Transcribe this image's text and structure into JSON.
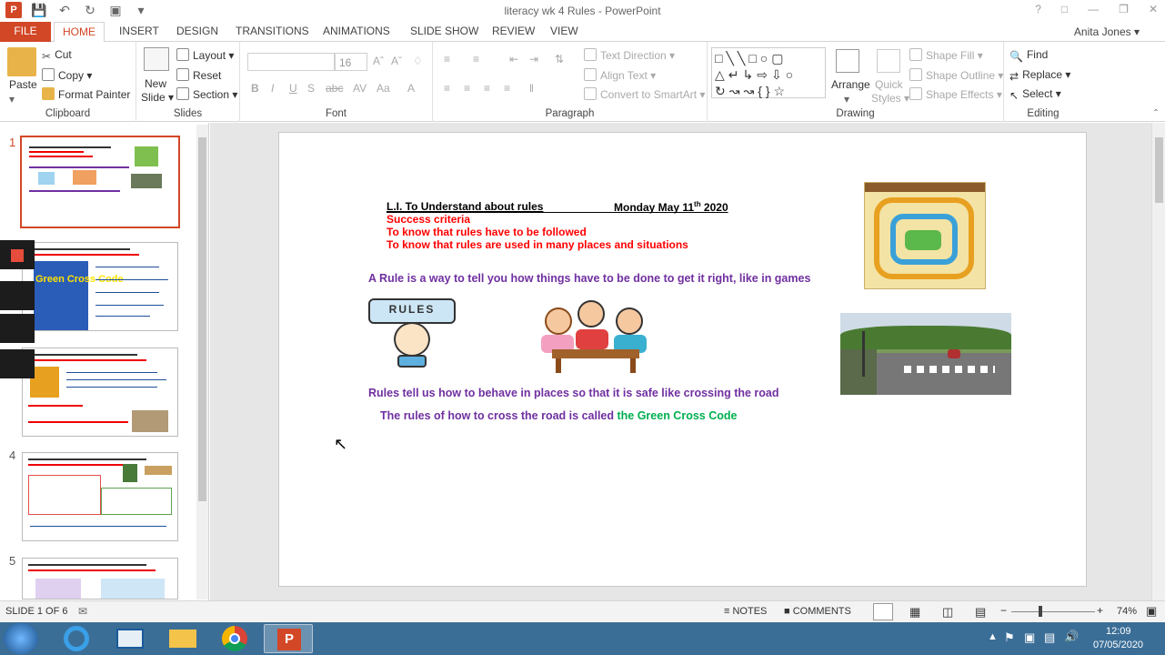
{
  "window": {
    "title": "literacy wk 4 Rules - PowerPoint",
    "user": "Anita Jones"
  },
  "tabs": [
    "FILE",
    "HOME",
    "INSERT",
    "DESIGN",
    "TRANSITIONS",
    "ANIMATIONS",
    "SLIDE SHOW",
    "REVIEW",
    "VIEW"
  ],
  "active_tab": "HOME",
  "ribbon": {
    "clipboard": {
      "label": "Clipboard",
      "paste": "Paste",
      "cut": "Cut",
      "copy": "Copy",
      "format_painter": "Format Painter"
    },
    "slides": {
      "label": "Slides",
      "new_slide_1": "New",
      "new_slide_2": "Slide",
      "layout": "Layout",
      "reset": "Reset",
      "section": "Section"
    },
    "font": {
      "label": "Font",
      "size": "16"
    },
    "paragraph": {
      "label": "Paragraph",
      "text_direction": "Text Direction",
      "align_text": "Align Text",
      "convert": "Convert to SmartArt"
    },
    "drawing": {
      "label": "Drawing",
      "arrange": "Arrange",
      "quick_styles_1": "Quick",
      "quick_styles_2": "Styles",
      "shape_fill": "Shape Fill",
      "shape_outline": "Shape Outline",
      "shape_effects": "Shape Effects"
    },
    "editing": {
      "label": "Editing",
      "find": "Find",
      "replace": "Replace",
      "select": "Select"
    }
  },
  "thumbnails": [
    "1",
    "4",
    "5"
  ],
  "slide": {
    "li_title": "L.I. To Understand about rules",
    "date_prefix": "Monday  May 11",
    "date_sup": "th",
    "date_year": " 2020",
    "success": "Success criteria",
    "crit1": "To know that  rules have to be followed",
    "crit2": "To know that rules are used in many places and situations",
    "rule_def": "A Rule is a way to tell you how things have to be done to get it right,  like in games",
    "rules_sign": "RULES",
    "rules_tell": "Rules tell us how to behave in places so that it is safe like crossing the road",
    "cross_prefix": "The rules of how to cross the road is called ",
    "cross_green": "the Green Cross Code"
  },
  "thumb2_title": "Green Cross Code",
  "status": {
    "slide": "SLIDE 1 OF 6",
    "notes": "NOTES",
    "comments": "COMMENTS",
    "zoom": "74%"
  },
  "clock": {
    "time": "12:09",
    "date": "07/05/2020"
  },
  "colors": {
    "accent": "#d24726",
    "purple": "#7030a0",
    "red": "#ff0000",
    "green": "#00b050"
  }
}
